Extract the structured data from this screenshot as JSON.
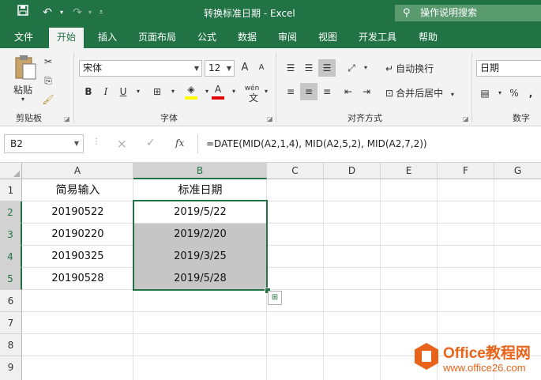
{
  "window": {
    "title": "转换标准日期  -  Excel",
    "tell_me": "操作说明搜索",
    "quick_access": {
      "save_icon": "save-icon",
      "undo_icon": "undo-icon",
      "redo_icon": "redo-icon",
      "customize_icon": "customize-icon"
    }
  },
  "tabs": [
    {
      "label": "文件"
    },
    {
      "label": "开始",
      "active": true
    },
    {
      "label": "插入"
    },
    {
      "label": "页面布局"
    },
    {
      "label": "公式"
    },
    {
      "label": "数据"
    },
    {
      "label": "审阅"
    },
    {
      "label": "视图"
    },
    {
      "label": "开发工具"
    },
    {
      "label": "帮助"
    }
  ],
  "ribbon": {
    "clipboard": {
      "paste_label": "粘贴",
      "group_label": "剪贴板"
    },
    "font": {
      "font_name": "宋体",
      "font_size": "12",
      "bold": "B",
      "italic": "I",
      "underline": "U",
      "grow": "A",
      "shrink": "A",
      "font_color": "A",
      "wen": "wén",
      "group_label": "字体"
    },
    "alignment": {
      "wrap_label": "自动换行",
      "merge_label": "合并后居中",
      "group_label": "对齐方式"
    },
    "number": {
      "format": "日期",
      "percent": "%",
      "comma": ",",
      "group_label": "数字"
    },
    "accent_color": "#217346"
  },
  "formula_bar": {
    "name_box": "B2",
    "cancel_icon": "×",
    "enter_icon": "✓",
    "fx": "fx",
    "formula": "=DATE(MID(A2,1,4), MID(A2,5,2), MID(A2,7,2))"
  },
  "sheet": {
    "columns": [
      "A",
      "B",
      "C",
      "D",
      "E",
      "F",
      "G"
    ],
    "rows": [
      "1",
      "2",
      "3",
      "4",
      "5",
      "6",
      "7",
      "8",
      "9"
    ],
    "header_a": "简易输入",
    "header_b": "标准日期",
    "data": [
      {
        "a": "20190522",
        "b": "2019/5/22"
      },
      {
        "a": "20190220",
        "b": "2019/2/20"
      },
      {
        "a": "20190325",
        "b": "2019/3/25"
      },
      {
        "a": "20190528",
        "b": "2019/5/28"
      }
    ]
  },
  "watermark": {
    "brand": "Office教程网",
    "url": "www.office26.com"
  }
}
